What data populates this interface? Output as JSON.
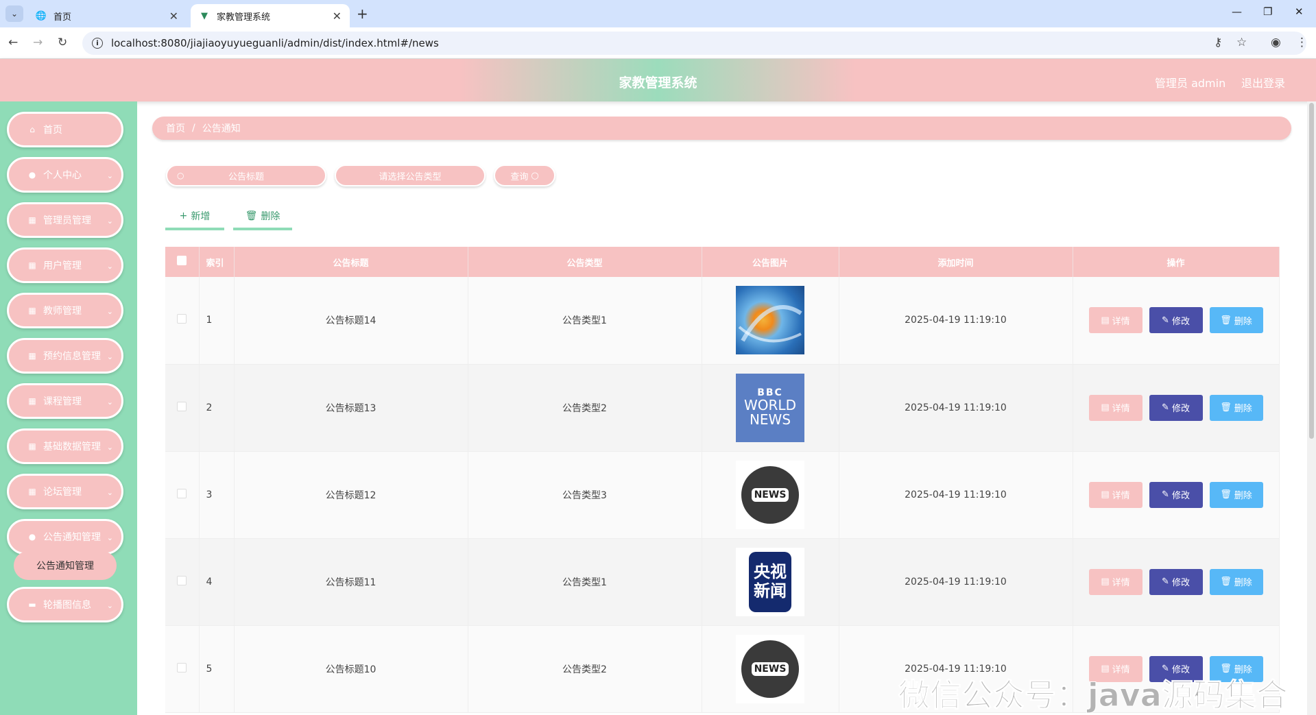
{
  "browser": {
    "tabs": [
      {
        "title": "首页",
        "icon": "globe-icon"
      },
      {
        "title": "家教管理系统",
        "icon": "vue-logo-icon"
      }
    ],
    "url": "localhost:8080/jiajiaoyuyueguanli/admin/dist/index.html#/news"
  },
  "header": {
    "title": "家教管理系统",
    "user_label": "管理员 admin",
    "logout_label": "退出登录",
    "gradient_colors": [
      "#f7c2c2",
      "#9cdcbc"
    ]
  },
  "sidebar": {
    "items": [
      {
        "label": "首页",
        "icon": "home-icon"
      },
      {
        "label": "个人中心",
        "icon": "user-icon"
      },
      {
        "label": "管理员管理",
        "icon": "grid-icon"
      },
      {
        "label": "用户管理",
        "icon": "grid-icon"
      },
      {
        "label": "教师管理",
        "icon": "grid-icon"
      },
      {
        "label": "预约信息管理",
        "icon": "grid-icon"
      },
      {
        "label": "课程管理",
        "icon": "grid-icon"
      },
      {
        "label": "基础数据管理",
        "icon": "grid-icon"
      },
      {
        "label": "论坛管理",
        "icon": "grid-icon"
      },
      {
        "label": "公告通知管理",
        "icon": "user-icon"
      },
      {
        "label": "轮播图信息",
        "icon": "ticket-icon"
      }
    ],
    "submenu": "公告通知管理"
  },
  "breadcrumb": {
    "home": "首页",
    "current": "公告通知"
  },
  "search": {
    "title_placeholder": "公告标题",
    "type_placeholder": "请选择公告类型",
    "query_label": "查询"
  },
  "actions": {
    "add": "新增",
    "delete": "删除"
  },
  "table": {
    "headers": [
      "索引",
      "公告标题",
      "公告类型",
      "公告图片",
      "添加时间",
      "操作"
    ],
    "rows": [
      {
        "index": "1",
        "title": "公告标题14",
        "type": "公告类型1",
        "image": "news-globe-image",
        "time": "2025-04-19 11:19:10"
      },
      {
        "index": "2",
        "title": "公告标题13",
        "type": "公告类型2",
        "image": "bbc-world-news-image",
        "time": "2025-04-19 11:19:10"
      },
      {
        "index": "3",
        "title": "公告标题12",
        "type": "公告类型3",
        "image": "news-badge-image",
        "time": "2025-04-19 11:19:10"
      },
      {
        "index": "4",
        "title": "公告标题11",
        "type": "公告类型1",
        "image": "cctv-news-image",
        "time": "2025-04-19 11:19:10"
      },
      {
        "index": "5",
        "title": "公告标题10",
        "type": "公告类型2",
        "image": "news-badge-image",
        "time": "2025-04-19 11:19:10"
      }
    ],
    "op_detail": "详情",
    "op_edit": "修改",
    "op_delete": "删除",
    "bbc_logo": "BBC",
    "bbc_world": "WORLD",
    "bbc_news": "NEWS",
    "news_badge": "NEWS",
    "cctv_line1": "央视",
    "cctv_line2": "新闻"
  },
  "watermark": "微信公众号：java源码集合"
}
